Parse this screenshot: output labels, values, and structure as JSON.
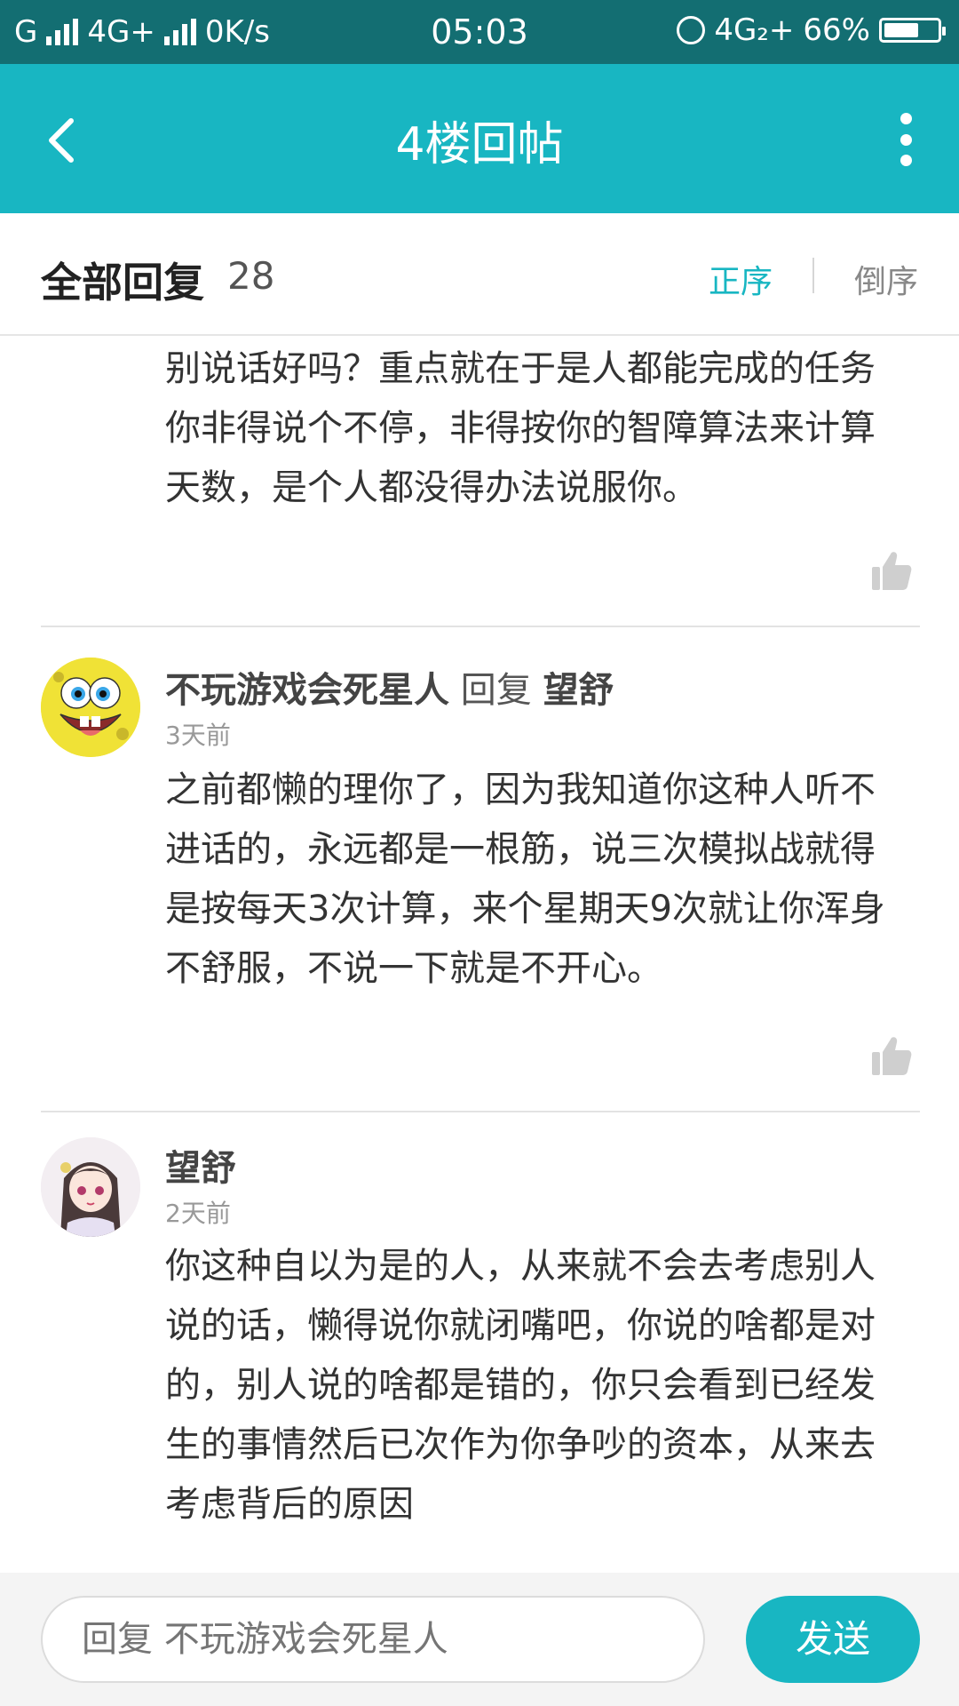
{
  "status_bar": {
    "left_network": "G",
    "network_type": "4G+",
    "speed": "0K/s",
    "time": "05:03",
    "right_network": "4G₂+",
    "battery_percent": "66%",
    "battery_level": 0.66
  },
  "header": {
    "title": "4楼回帖",
    "back_icon": "chevron-left-icon",
    "more_icon": "more-vertical-icon"
  },
  "replies_bar": {
    "label": "全部回复",
    "count": "28",
    "sort_asc": "正序",
    "sort_desc": "倒序",
    "active_color": "#18b6c2"
  },
  "comments": [
    {
      "text_lines": [
        "别说话好吗？重点就在于是人都能完成的任务",
        "你非得说个不停，非得按你的智障算法来计算",
        "天数，是个人都没得办法说服你。"
      ]
    },
    {
      "author": "不玩游戏会死星人",
      "reply_word": "回复",
      "reply_to": "望舒",
      "time": "3天前",
      "avatar_icon": "spongebob-avatar",
      "text_lines": [
        "之前都懒的理你了，因为我知道你这种人听不",
        "进话的，永远都是一根筋，说三次模拟战就得",
        "是按每天3次计算，来个星期天9次就让你浑身",
        "不舒服，不说一下就是不开心。"
      ]
    },
    {
      "author": "望舒",
      "time": "2天前",
      "avatar_icon": "anime-girl-avatar",
      "text_lines": [
        "你这种自以为是的人，从来就不会去考虑别人",
        "说的话，懒得说你就闭嘴吧，你说的啥都是对",
        "的，别人说的啥都是错的，你只会看到已经发",
        "生的事情然后已次作为你争吵的资本，从来去",
        "考虑背后的原因"
      ]
    }
  ],
  "bottom_bar": {
    "input_placeholder": "回复 不玩游戏会死星人",
    "send_label": "发送"
  },
  "colors": {
    "status_bar": "#136e72",
    "header": "#18b6c2",
    "accent": "#18b6c2"
  }
}
